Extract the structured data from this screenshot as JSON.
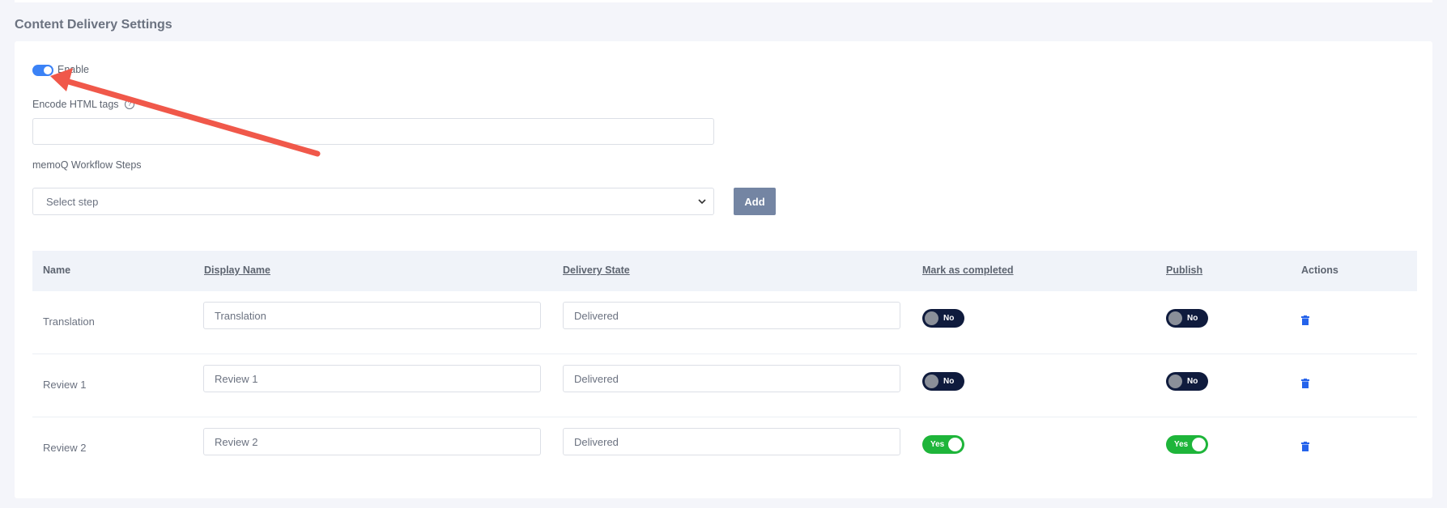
{
  "section": {
    "title": "Content Delivery Settings"
  },
  "enable": {
    "label": "Enable",
    "checked": true
  },
  "encode": {
    "label": "Encode HTML tags",
    "value": "",
    "help_icon": "?"
  },
  "steps": {
    "label": "memoQ Workflow Steps",
    "select_placeholder": "Select step",
    "add_label": "Add"
  },
  "table": {
    "headers": {
      "name": "Name",
      "display_name": "Display Name",
      "delivery_state": "Delivery State",
      "mark_completed": "Mark as completed",
      "publish": "Publish",
      "actions": "Actions"
    },
    "rows": [
      {
        "name": "Translation",
        "display_name": "Translation",
        "delivery_state": "Delivered",
        "mark_completed": "No",
        "publish": "No"
      },
      {
        "name": "Review 1",
        "display_name": "Review 1",
        "delivery_state": "Delivered",
        "mark_completed": "No",
        "publish": "No"
      },
      {
        "name": "Review 2",
        "display_name": "Review 2",
        "delivery_state": "Delivered",
        "mark_completed": "Yes",
        "publish": "Yes"
      }
    ]
  },
  "colors": {
    "primary": "#3b82f6",
    "toggle_off": "#0f1b3d",
    "toggle_on": "#1eb53a",
    "add_button": "#7485a3",
    "annotation_arrow": "#f0584a"
  }
}
